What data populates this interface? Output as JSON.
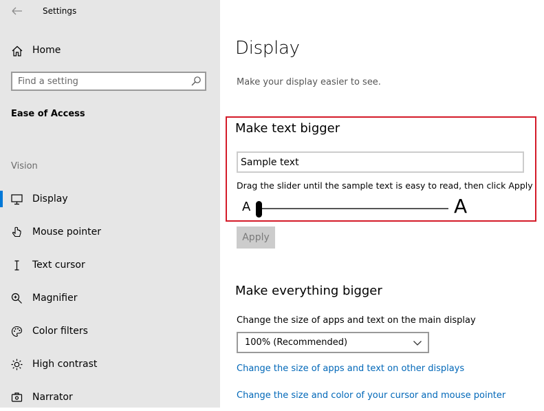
{
  "window": {
    "title": "Settings"
  },
  "sidebar": {
    "home_label": "Home",
    "search_placeholder": "Find a setting",
    "section_title": "Ease of Access",
    "group_label": "Vision",
    "items": [
      {
        "label": "Display",
        "icon": "monitor-icon",
        "active": true
      },
      {
        "label": "Mouse pointer",
        "icon": "mouse-pointer-icon"
      },
      {
        "label": "Text cursor",
        "icon": "text-cursor-icon"
      },
      {
        "label": "Magnifier",
        "icon": "magnifier-icon"
      },
      {
        "label": "Color filters",
        "icon": "palette-icon"
      },
      {
        "label": "High contrast",
        "icon": "high-contrast-icon"
      },
      {
        "label": "Narrator",
        "icon": "narrator-icon"
      }
    ]
  },
  "main": {
    "title": "Display",
    "subtitle": "Make your display easier to see.",
    "text_bigger": {
      "heading": "Make text bigger",
      "sample_text": "Sample text",
      "instruction": "Drag the slider until the sample text is easy to read, then click Apply",
      "slider_min_label": "A",
      "slider_max_label": "A",
      "slider_value_percent": 0,
      "apply_label": "Apply"
    },
    "everything_bigger": {
      "heading": "Make everything bigger",
      "size_label": "Change the size of apps and text on the main display",
      "selected_scale": "100% (Recommended)",
      "link_other_displays": "Change the size of apps and text on other displays",
      "link_cursor": "Change the size and color of your cursor and mouse pointer"
    }
  },
  "colors": {
    "accent": "#0078d7",
    "link": "#0067b8",
    "highlight_border": "#d41a28",
    "sidebar_bg": "#e6e6e6"
  }
}
